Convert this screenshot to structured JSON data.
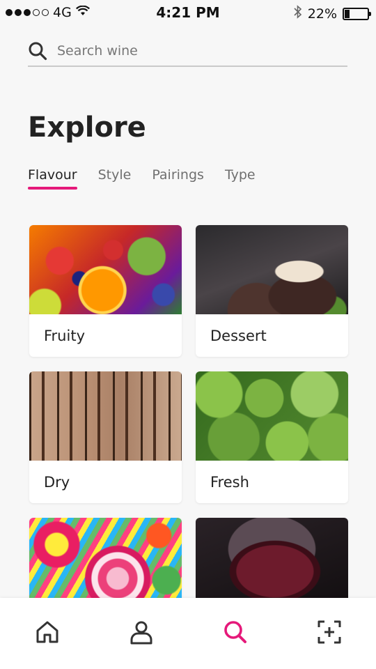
{
  "status_bar": {
    "carrier": "4G",
    "time": "4:21 PM",
    "battery_percent": "22%",
    "battery_level": 0.22,
    "icons": [
      "signal-dots-icon",
      "wifi-icon",
      "bluetooth-icon",
      "battery-icon"
    ]
  },
  "search": {
    "placeholder": "Search wine",
    "value": "",
    "icon": "search-icon"
  },
  "page": {
    "title": "Explore"
  },
  "tabs": [
    {
      "label": "Flavour",
      "active": true
    },
    {
      "label": "Style",
      "active": false
    },
    {
      "label": "Pairings",
      "active": false
    },
    {
      "label": "Type",
      "active": false
    }
  ],
  "cards": [
    {
      "label": "Fruity",
      "image": "fruits-photo"
    },
    {
      "label": "Dessert",
      "image": "chocolate-cupcake-photo"
    },
    {
      "label": "Dry",
      "image": "dry-wood-photo"
    },
    {
      "label": "Fresh",
      "image": "green-lettuce-photo"
    },
    {
      "label": "",
      "image": "candy-photo"
    },
    {
      "label": "",
      "image": "red-wine-glass-photo"
    }
  ],
  "bottom_nav": {
    "items": [
      {
        "icon": "home-icon",
        "active": false
      },
      {
        "icon": "profile-icon",
        "active": false
      },
      {
        "icon": "search-icon",
        "active": true
      },
      {
        "icon": "scan-add-icon",
        "active": false
      }
    ]
  },
  "colors": {
    "accent": "#e5197a",
    "background": "#f7f7f7",
    "text": "#222222",
    "muted_text": "#6f6f6f"
  }
}
